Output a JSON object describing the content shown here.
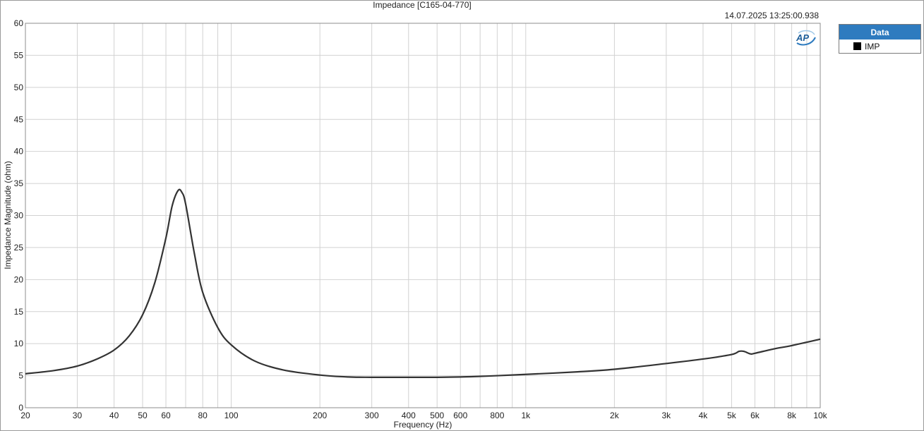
{
  "chart_data": {
    "type": "line",
    "title": "Impedance [C165-04-770]",
    "timestamp": "14.07.2025 13:25:00.938",
    "xlabel": "Frequency (Hz)",
    "ylabel": "Impedance Magnitude (ohm)",
    "xscale": "log",
    "xlim": [
      20,
      10000
    ],
    "ylim": [
      0,
      60
    ],
    "grid": true,
    "legend_placement": "right",
    "x_ticks": [
      {
        "value": 20,
        "label": "20"
      },
      {
        "value": 30,
        "label": "30"
      },
      {
        "value": 40,
        "label": "40"
      },
      {
        "value": 50,
        "label": "50"
      },
      {
        "value": 60,
        "label": "60"
      },
      {
        "value": 80,
        "label": "80"
      },
      {
        "value": 100,
        "label": "100"
      },
      {
        "value": 200,
        "label": "200"
      },
      {
        "value": 300,
        "label": "300"
      },
      {
        "value": 400,
        "label": "400"
      },
      {
        "value": 500,
        "label": "500"
      },
      {
        "value": 600,
        "label": "600"
      },
      {
        "value": 800,
        "label": "800"
      },
      {
        "value": 1000,
        "label": "1k"
      },
      {
        "value": 2000,
        "label": "2k"
      },
      {
        "value": 3000,
        "label": "3k"
      },
      {
        "value": 4000,
        "label": "4k"
      },
      {
        "value": 5000,
        "label": "5k"
      },
      {
        "value": 6000,
        "label": "6k"
      },
      {
        "value": 8000,
        "label": "8k"
      },
      {
        "value": 10000,
        "label": "10k"
      }
    ],
    "y_ticks": [
      0,
      5,
      10,
      15,
      20,
      25,
      30,
      35,
      40,
      45,
      50,
      55,
      60
    ],
    "legend_title": "Data",
    "series": [
      {
        "name": "IMP",
        "color": "#333333",
        "x": [
          20,
          25,
          30,
          35,
          40,
          45,
          50,
          55,
          60,
          63,
          66,
          68,
          70,
          75,
          80,
          90,
          100,
          120,
          150,
          200,
          250,
          300,
          400,
          500,
          600,
          700,
          800,
          1000,
          1500,
          2000,
          3000,
          4000,
          5000,
          5300,
          5500,
          5800,
          6000,
          7000,
          8000,
          10000
        ],
        "y": [
          5.3,
          5.8,
          6.5,
          7.6,
          9.0,
          11.2,
          14.5,
          19.5,
          26.5,
          31.5,
          33.9,
          33.6,
          31.8,
          24.0,
          18.0,
          12.5,
          9.8,
          7.3,
          5.9,
          5.1,
          4.8,
          4.75,
          4.75,
          4.75,
          4.8,
          4.9,
          5.0,
          5.2,
          5.6,
          6.0,
          6.9,
          7.6,
          8.3,
          8.8,
          8.8,
          8.4,
          8.5,
          9.2,
          9.7,
          10.7
        ]
      }
    ]
  }
}
